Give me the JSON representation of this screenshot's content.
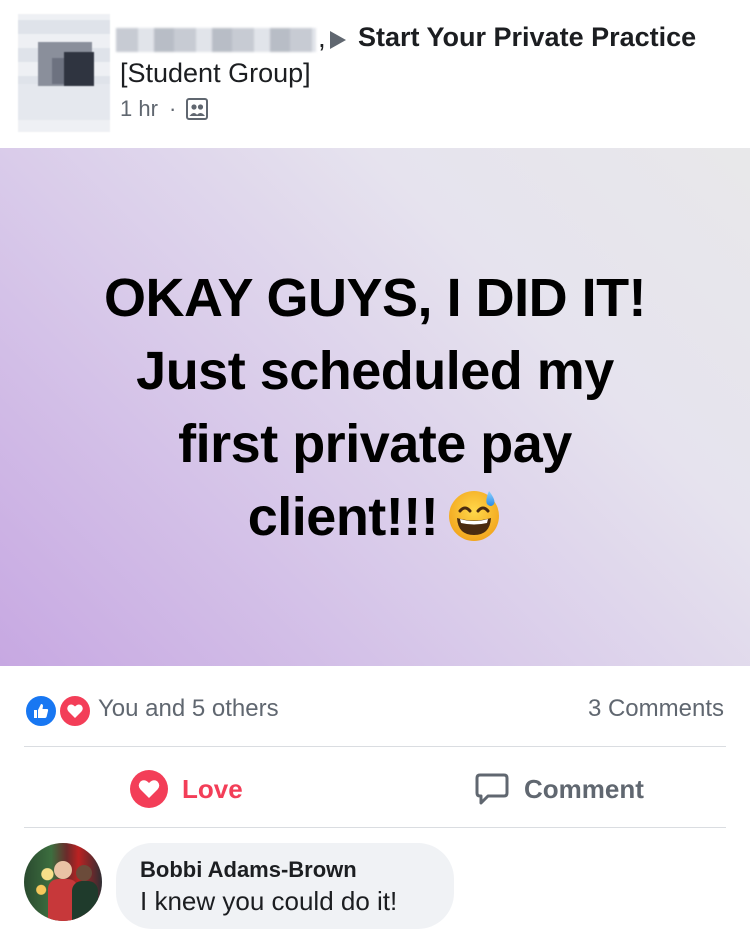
{
  "header": {
    "separator": ",",
    "group_name": "Start Your Private Practice",
    "group_tag": "[Student Group]",
    "time": "1 hr",
    "dot": "·",
    "privacy_icon": "group-icon"
  },
  "post": {
    "lines": [
      "OKAY GUYS, I DID IT!",
      "Just scheduled my",
      "first private pay",
      "client!!!"
    ],
    "emoji": "grinning-face-with-sweat-emoji",
    "background_colors": [
      "#c7a8e2",
      "#e8e8ea"
    ]
  },
  "reactions": {
    "icons": [
      "like-icon",
      "love-icon"
    ],
    "text": "You and 5 others",
    "comments_count": "3 Comments",
    "like_color": "#1877f2",
    "love_color": "#f33e58"
  },
  "actions": {
    "love_label": "Love",
    "comment_label": "Comment"
  },
  "comment": {
    "author": "Bobbi Adams-Brown",
    "text": "I knew you could do it!"
  }
}
